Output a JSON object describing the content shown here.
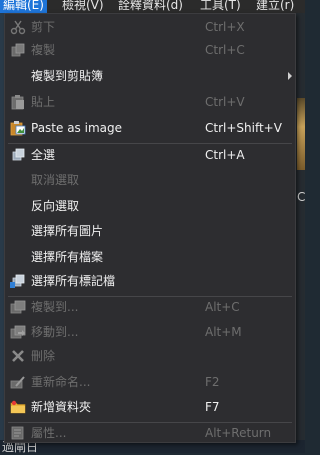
{
  "menubar": {
    "items": [
      {
        "label": "編輯(E)"
      },
      {
        "label": "檢視(V)"
      },
      {
        "label": "詮釋資料(d)"
      },
      {
        "label": "工具(T)"
      },
      {
        "label": "建立(r)"
      }
    ]
  },
  "background": {
    "bottom_text": "過閘日",
    "peek_text": "C"
  },
  "menu": {
    "items": [
      {
        "label": "剪下",
        "shortcut": "Ctrl+X",
        "icon": "scissors-icon",
        "enabled": false
      },
      {
        "label": "複製",
        "shortcut": "Ctrl+C",
        "icon": "copy-icon",
        "enabled": false
      },
      {
        "label": "複製到剪貼簿",
        "shortcut": "",
        "icon": "",
        "enabled": true,
        "submenu": true
      },
      {
        "label": "貼上",
        "shortcut": "Ctrl+V",
        "icon": "paste-icon",
        "enabled": false
      },
      {
        "label": "Paste as image",
        "shortcut": "Ctrl+Shift+V",
        "icon": "paste-image-icon",
        "enabled": true
      },
      {
        "label": "全選",
        "shortcut": "Ctrl+A",
        "icon": "select-all-icon",
        "enabled": true
      },
      {
        "label": "取消選取",
        "shortcut": "",
        "icon": "",
        "enabled": false
      },
      {
        "label": "反向選取",
        "shortcut": "",
        "icon": "",
        "enabled": true
      },
      {
        "label": "選擇所有圖片",
        "shortcut": "",
        "icon": "",
        "enabled": true
      },
      {
        "label": "選擇所有檔案",
        "shortcut": "",
        "icon": "",
        "enabled": true
      },
      {
        "label": "選擇所有標記檔",
        "shortcut": "",
        "icon": "tagged-files-icon",
        "enabled": true
      },
      {
        "label": "複製到...",
        "shortcut": "Alt+C",
        "icon": "copy-to-icon",
        "enabled": false
      },
      {
        "label": "移動到...",
        "shortcut": "Alt+M",
        "icon": "move-to-icon",
        "enabled": false
      },
      {
        "label": "刪除",
        "shortcut": "",
        "icon": "delete-icon",
        "enabled": false
      },
      {
        "label": "重新命名...",
        "shortcut": "F2",
        "icon": "rename-icon",
        "enabled": false
      },
      {
        "label": "新增資料夾",
        "shortcut": "F7",
        "icon": "new-folder-icon",
        "enabled": true
      },
      {
        "label": "屬性...",
        "shortcut": "Alt+Return",
        "icon": "properties-icon",
        "enabled": false
      }
    ]
  },
  "colors": {
    "menu_bg": "#2d2d30",
    "menubar_active": "#1e74d8",
    "text_enabled": "#f0f0f0",
    "text_disabled": "#6e6e6e"
  }
}
